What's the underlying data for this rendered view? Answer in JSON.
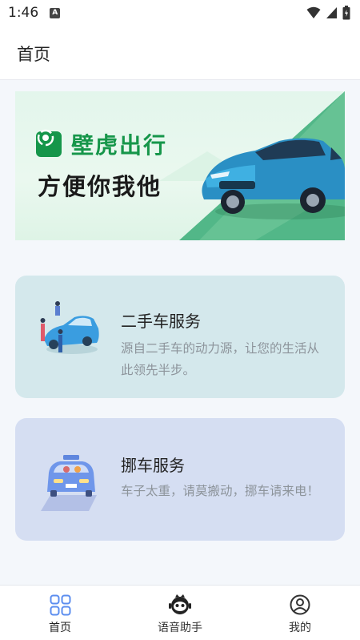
{
  "status_bar": {
    "time": "1:46",
    "app_icon": "A"
  },
  "app_bar": {
    "title": "首页"
  },
  "banner": {
    "brand_name": "壁虎出行",
    "slogan": "方便你我他"
  },
  "services": [
    {
      "title": "二手车服务",
      "description": "源自二手车的动力源，让您的生活从此领先半步。",
      "icon": "used-car-illustration"
    },
    {
      "title": "挪车服务",
      "description": "车子太重，请莫搬动，挪车请来电！",
      "icon": "taxi-illustration"
    }
  ],
  "bottom_nav": {
    "items": [
      {
        "label": "首页",
        "icon": "grid-icon",
        "active": true
      },
      {
        "label": "语音助手",
        "icon": "voice-assistant-icon",
        "active": false
      },
      {
        "label": "我的",
        "icon": "user-icon",
        "active": false
      }
    ]
  },
  "colors": {
    "brand_green": "#16964a",
    "card_used_bg": "#d4e8ec",
    "card_move_bg": "#d5def2",
    "nav_active": "#5b8def"
  }
}
